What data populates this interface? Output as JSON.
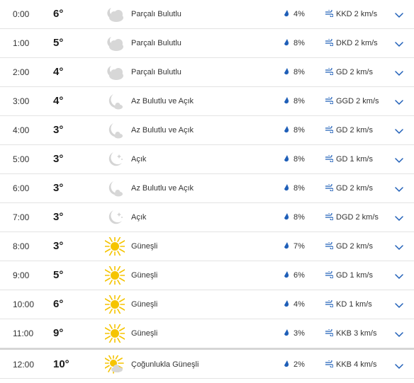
{
  "rows": [
    {
      "time": "0:00",
      "temp": "6°",
      "icon": "partly-cloudy-night-icon",
      "condition": "Parçalı Bulutlu",
      "precip": "4%",
      "wind": "KKD 2 km/s"
    },
    {
      "time": "1:00",
      "temp": "5°",
      "icon": "partly-cloudy-night-icon",
      "condition": "Parçalı Bulutlu",
      "precip": "8%",
      "wind": "DKD 2 km/s"
    },
    {
      "time": "2:00",
      "temp": "4°",
      "icon": "partly-cloudy-night-icon",
      "condition": "Parçalı Bulutlu",
      "precip": "8%",
      "wind": "GD 2 km/s"
    },
    {
      "time": "3:00",
      "temp": "4°",
      "icon": "mostly-clear-night-icon",
      "condition": "Az Bulutlu ve Açık",
      "precip": "8%",
      "wind": "GGD 2 km/s"
    },
    {
      "time": "4:00",
      "temp": "3°",
      "icon": "mostly-clear-night-icon",
      "condition": "Az Bulutlu ve Açık",
      "precip": "8%",
      "wind": "GD 2 km/s"
    },
    {
      "time": "5:00",
      "temp": "3°",
      "icon": "clear-night-icon",
      "condition": "Açık",
      "precip": "8%",
      "wind": "GD 1 km/s"
    },
    {
      "time": "6:00",
      "temp": "3°",
      "icon": "mostly-clear-night-icon",
      "condition": "Az Bulutlu ve Açık",
      "precip": "8%",
      "wind": "GD 2 km/s"
    },
    {
      "time": "7:00",
      "temp": "3°",
      "icon": "clear-night-icon",
      "condition": "Açık",
      "precip": "8%",
      "wind": "DGD 2 km/s"
    },
    {
      "time": "8:00",
      "temp": "3°",
      "icon": "sunny-icon",
      "condition": "Güneşli",
      "precip": "7%",
      "wind": "GD 2 km/s"
    },
    {
      "time": "9:00",
      "temp": "5°",
      "icon": "sunny-icon",
      "condition": "Güneşli",
      "precip": "6%",
      "wind": "GD 1 km/s"
    },
    {
      "time": "10:00",
      "temp": "6°",
      "icon": "sunny-icon",
      "condition": "Güneşli",
      "precip": "4%",
      "wind": "KD 1 km/s"
    },
    {
      "time": "11:00",
      "temp": "9°",
      "icon": "sunny-icon",
      "condition": "Güneşli",
      "precip": "3%",
      "wind": "KKB 3 km/s"
    },
    {
      "time": "12:00",
      "temp": "10°",
      "icon": "mostly-sunny-icon",
      "condition": "Çoğunlukla Güneşli",
      "precip": "2%",
      "wind": "KKB 4 km/s"
    }
  ],
  "colors": {
    "drop": "#1f5fb8",
    "wind": "#1f5fb8",
    "chevron": "#1f5fb8",
    "sun": "#f5c400",
    "moon": "#d4d4d4",
    "cloud": "#d7d7d7"
  }
}
